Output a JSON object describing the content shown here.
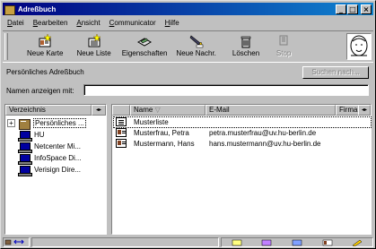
{
  "window": {
    "title": "Adreßbuch"
  },
  "titlebar_buttons": {
    "minimize": "_",
    "maximize": "□",
    "close": "×"
  },
  "menu": [
    {
      "label": "Datei",
      "accel": "D",
      "rest": "atei"
    },
    {
      "label": "Bearbeiten",
      "accel": "B",
      "rest": "earbeiten"
    },
    {
      "label": "Ansicht",
      "accel": "A",
      "rest": "nsicht"
    },
    {
      "label": "Communicator",
      "accel": "C",
      "rest": "ommunicator"
    },
    {
      "label": "Hilfe",
      "accel": "H",
      "rest": "ilfe"
    }
  ],
  "toolbar": {
    "new_card": "Neue Karte",
    "new_list": "Neue Liste",
    "properties": "Eigenschaften",
    "new_message": "Neue Nachr.",
    "delete": "Löschen",
    "stop": "Stop"
  },
  "section_title": "Persönliches Adreßbuch",
  "search_button": "Suchen nach...",
  "name_field": {
    "label": "Namen anzeigen mit:",
    "value": ""
  },
  "directory": {
    "header": "Verzeichnis",
    "expander": "+",
    "items": [
      {
        "label": "Persönliches ...",
        "icon": "address-book-icon"
      },
      {
        "label": "HU",
        "icon": "directory-server-icon"
      },
      {
        "label": "Netcenter Mi...",
        "icon": "directory-server-icon"
      },
      {
        "label": "InfoSpace Di...",
        "icon": "directory-server-icon"
      },
      {
        "label": "Verisign Dire...",
        "icon": "directory-server-icon"
      }
    ]
  },
  "contacts": {
    "columns": {
      "name": "Name",
      "sort_indicator": "▽",
      "email": "E-Mail",
      "company": "Firma"
    },
    "rows": [
      {
        "name": "Musterliste",
        "email": "",
        "type": "list"
      },
      {
        "name": "Musterfrau, Petra",
        "email": "petra.musterfrau@uv.hu-berlin.de",
        "type": "card"
      },
      {
        "name": "Mustermann, Hans",
        "email": "hans.mustermann@uv.hu-berlin.de",
        "type": "card"
      }
    ]
  },
  "header_arrows": "◂▸"
}
